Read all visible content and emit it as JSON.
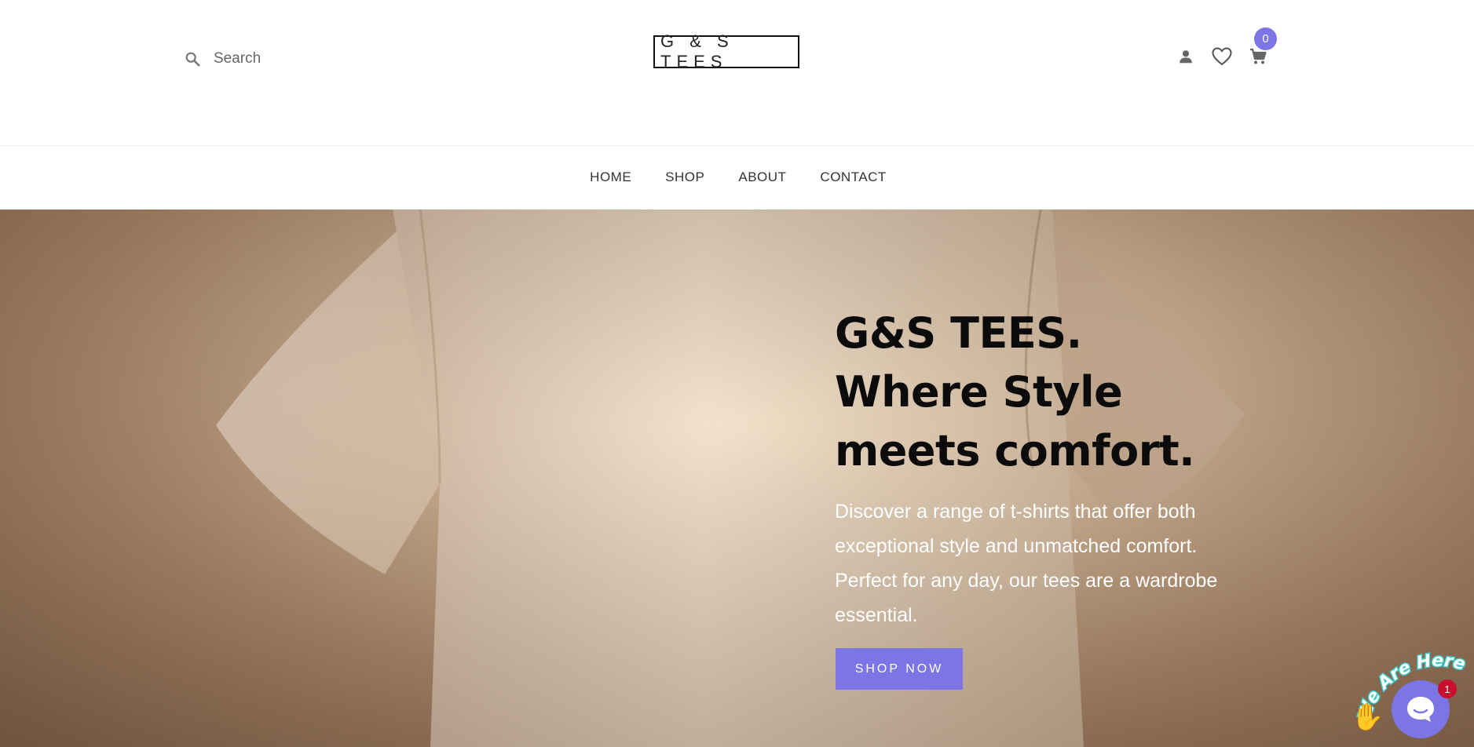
{
  "header": {
    "search_label": "Search",
    "logo_text": "G & S TEES",
    "cart_count": "0"
  },
  "nav": {
    "items": [
      {
        "label": "HOME"
      },
      {
        "label": "SHOP"
      },
      {
        "label": "ABOUT"
      },
      {
        "label": "CONTACT"
      }
    ]
  },
  "hero": {
    "title": "G&S TEES. Where Style meets comfort.",
    "subtitle": "Discover a range of t-shirts that offer both exceptional style and unmatched comfort. Perfect for any day, our tees are a wardrobe essential.",
    "cta_label": "SHOP NOW"
  },
  "chat": {
    "tagline": "We Are Here!",
    "unread_count": "1"
  },
  "icons": {
    "search": "search-icon",
    "account": "user-icon",
    "wishlist": "heart-icon",
    "cart": "cart-icon",
    "chat": "chat-icon",
    "wave": "waving-hand-icon"
  },
  "colors": {
    "accent": "#7b75e6",
    "badge_red": "#c8102e",
    "hero_text": "#0b0b0b",
    "hero_sub": "#ffffff"
  }
}
